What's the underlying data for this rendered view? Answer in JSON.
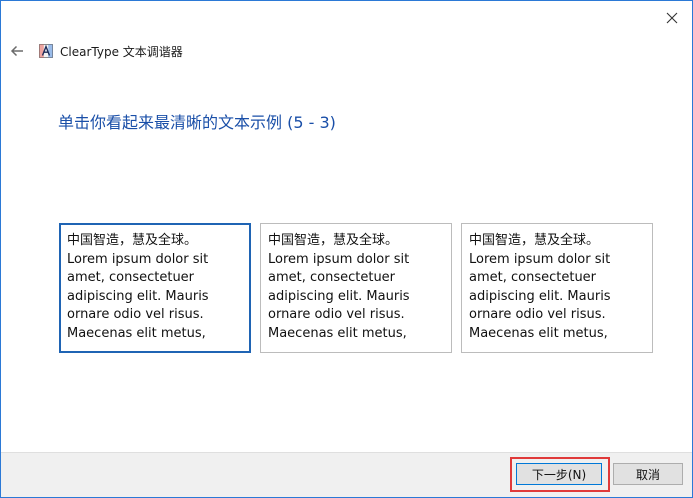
{
  "window": {
    "title": "ClearType 文本调谐器",
    "close_icon": "close-icon",
    "back_icon": "back-arrow-icon",
    "app_icon": "cleartype-icon",
    "border_color": "#2b79d6"
  },
  "main": {
    "heading": "单击你看起来最清晰的文本示例 (5 - 3)",
    "heading_color": "#1a4fa8",
    "selected_sample_index": 0,
    "samples": [
      {
        "line1": "中国智造，慧及全球。",
        "line2": "Lorem ipsum dolor sit",
        "line3": "amet, consectetuer",
        "line4": "adipiscing elit. Mauris",
        "line5": "ornare odio vel risus.",
        "line6": "Maecenas elit metus,"
      },
      {
        "line1": "中国智造，慧及全球。",
        "line2": "Lorem ipsum dolor sit",
        "line3": "amet, consectetuer",
        "line4": "adipiscing elit. Mauris",
        "line5": "ornare odio vel risus.",
        "line6": "Maecenas elit metus,"
      },
      {
        "line1": "中国智造，慧及全球。",
        "line2": "Lorem ipsum dolor sit",
        "line3": "amet, consectetuer",
        "line4": "adipiscing elit. Mauris",
        "line5": "ornare odio vel risus.",
        "line6": "Maecenas elit metus,"
      }
    ]
  },
  "footer": {
    "next_label": "下一步(N)",
    "cancel_label": "取消",
    "highlight_color": "#e03a3a"
  }
}
